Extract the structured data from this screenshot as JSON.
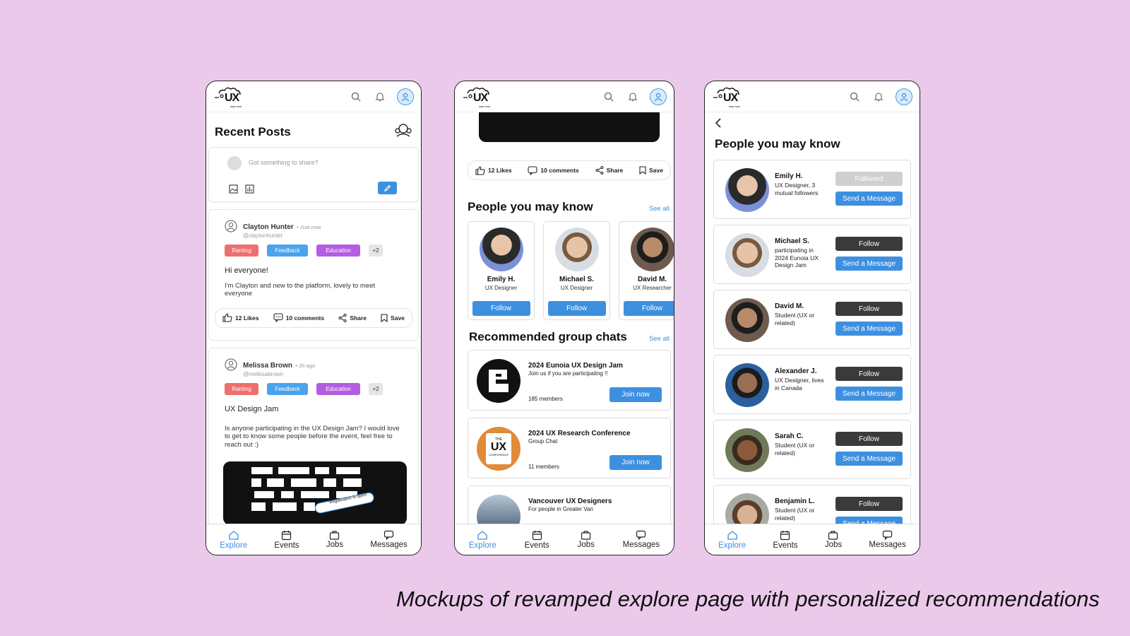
{
  "common": {
    "logo_text": "UX",
    "logo_sub": "was here",
    "nav": [
      {
        "label": "Explore",
        "icon": "home-icon"
      },
      {
        "label": "Events",
        "icon": "calendar-icon"
      },
      {
        "label": "Jobs",
        "icon": "briefcase-icon"
      },
      {
        "label": "Messages",
        "icon": "chat-icon"
      }
    ]
  },
  "screen1": {
    "title": "Recent Posts",
    "composer_placeholder": "Got something to share?",
    "posts": [
      {
        "name": "Clayton Hunter",
        "time": "• Just now",
        "handle": "@claytonhunter",
        "tags": [
          "Ranting",
          "Feedback",
          "Education",
          "+2"
        ],
        "title": "Hi everyone!",
        "body": "I'm Clayton and new to the platform, lovely to meet everyone",
        "likes": "12 Likes",
        "comments": "10 comments",
        "share": "Share",
        "save": "Save"
      },
      {
        "name": "Melissa Brown",
        "time": "• 2h ago",
        "handle": "@melissabrown",
        "tags": [
          "Ranting",
          "Feedback",
          "Education",
          "+2"
        ],
        "title": "UX Design Jam",
        "body": "Is anyone participating in the UX Design Jam? I would love to get to know some people before the event, feel free to reach out :)",
        "banner_label": "Registration is open!"
      }
    ]
  },
  "screen2": {
    "actions": {
      "likes": "12 Likes",
      "comments": "10 comments",
      "share": "Share",
      "save": "Save"
    },
    "people_title": "People you may know",
    "see_all": "See all",
    "people": [
      {
        "name": "Emily H.",
        "role": "UX Designer",
        "button": "Follow",
        "color": "#7b90d9"
      },
      {
        "name": "Michael S.",
        "role": "UX Designer",
        "button": "Follow",
        "color": "#c9a58c"
      },
      {
        "name": "David M.",
        "role": "UX Researcher",
        "button": "Follow",
        "color": "#6e5a4e"
      }
    ],
    "groups_title": "Recommended group chats",
    "groups": [
      {
        "title": "2024 Eunoia UX Design Jam",
        "subtitle": "Join us if you are participating !!",
        "members": "185 members",
        "button": "Join now"
      },
      {
        "title": "2024 UX Research Conference",
        "subtitle": "Group Chat",
        "members": "11 members",
        "button": "Join now",
        "logo_text": "UX",
        "logo_small": "THE",
        "logo_bottom": "CONFERENCE"
      },
      {
        "title": "Vancouver UX Designers",
        "subtitle": "For people in Greater Van"
      }
    ]
  },
  "screen3": {
    "title": "People you may know",
    "people": [
      {
        "name": "Emily H.",
        "desc": "UX Designer, 3 mutual followers",
        "follow": "Followed",
        "message": "Send a Message",
        "followed": true,
        "color": "#7b90d9"
      },
      {
        "name": "Michael S.",
        "desc": "participating in 2024 Eunoia UX Design Jam",
        "follow": "Follow",
        "message": "Send a Message",
        "followed": false,
        "color": "#c9a58c"
      },
      {
        "name": "David M.",
        "desc": "Student (UX or related)",
        "follow": "Follow",
        "message": "Send a Message",
        "followed": false,
        "color": "#6e5a4e"
      },
      {
        "name": "Alexander J.",
        "desc": "UX Designer, lives in Canada",
        "follow": "Follow",
        "message": "Send a Message",
        "followed": false,
        "color": "#2b5f9e"
      },
      {
        "name": "Sarah C.",
        "desc": "Student (UX or related)",
        "follow": "Follow",
        "message": "Send a Message",
        "followed": false,
        "color": "#8a5a3c"
      },
      {
        "name": "Benjamin L.",
        "desc": "Student (UX or related)",
        "follow": "Follow",
        "message": "Send a Message",
        "followed": false,
        "color": "#b8967a"
      }
    ]
  },
  "caption": "Mockups of revamped explore page with personalized recommendations",
  "colors": {
    "background": "#ebc9ea",
    "accent": "#3d8fe0",
    "dark_button": "#3a3a3a"
  }
}
